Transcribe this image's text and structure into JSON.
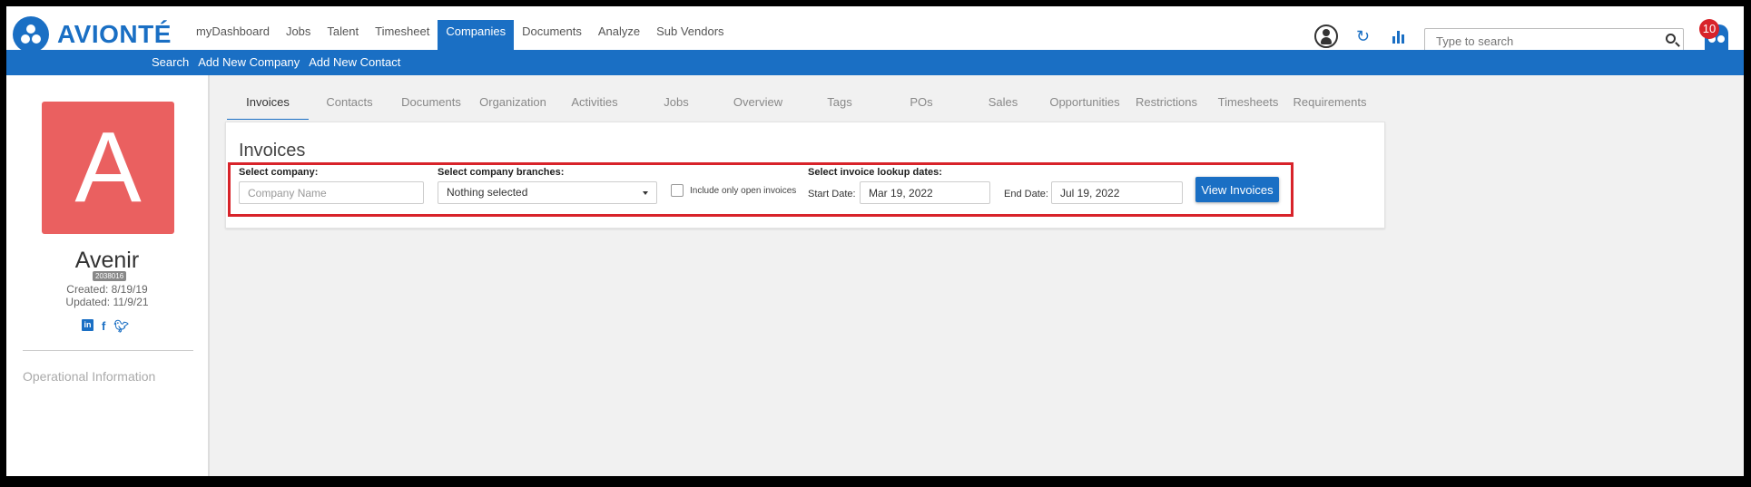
{
  "app": {
    "logo_text": "AVIONTÉ"
  },
  "nav": {
    "items": [
      {
        "label": "myDashboard"
      },
      {
        "label": "Jobs"
      },
      {
        "label": "Talent"
      },
      {
        "label": "Timesheet"
      },
      {
        "label": "Companies",
        "active": true
      },
      {
        "label": "Documents"
      },
      {
        "label": "Analyze"
      },
      {
        "label": "Sub Vendors"
      }
    ],
    "search_placeholder": "Type to search",
    "notification_count": "10"
  },
  "subnav": {
    "items": [
      {
        "label": "Search"
      },
      {
        "label": "Add New Company"
      },
      {
        "label": "Add New Contact"
      }
    ]
  },
  "company": {
    "avatar_letter": "A",
    "name": "Avenir",
    "id": "2038016",
    "created": "Created: 8/19/19",
    "updated": "Updated: 11/9/21",
    "section_label": "Operational Information"
  },
  "tabs": [
    {
      "label": "Invoices",
      "active": true
    },
    {
      "label": "Contacts"
    },
    {
      "label": "Documents"
    },
    {
      "label": "Organization"
    },
    {
      "label": "Activities"
    },
    {
      "label": "Jobs"
    },
    {
      "label": "Overview"
    },
    {
      "label": "Tags"
    },
    {
      "label": "POs"
    },
    {
      "label": "Sales"
    },
    {
      "label": "Opportunities"
    },
    {
      "label": "Restrictions"
    },
    {
      "label": "Timesheets"
    },
    {
      "label": "Requirements"
    }
  ],
  "invoices": {
    "title": "Invoices",
    "select_company_label": "Select company:",
    "company_placeholder": "Company Name",
    "branches_label": "Select company branches:",
    "branches_value": "Nothing selected",
    "open_only_label": "Include only open invoices",
    "dates_label": "Select invoice lookup dates:",
    "start_label": "Start Date:",
    "start_value": "Mar 19, 2022",
    "end_label": "End Date:",
    "end_value": "Jul 19, 2022",
    "view_button": "View Invoices"
  },
  "colors": {
    "brand": "#1a6fc4",
    "avatar": "#ea6060",
    "highlight": "#d8232a"
  }
}
